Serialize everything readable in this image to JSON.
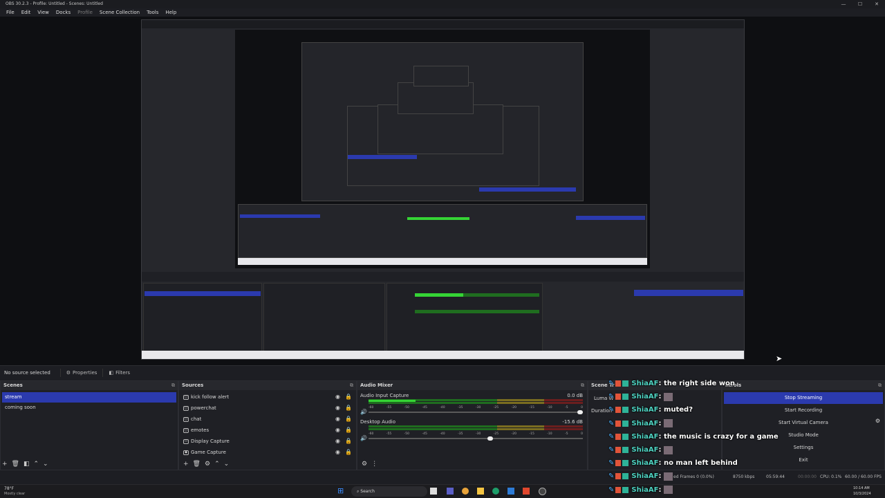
{
  "window": {
    "title": "OBS 30.2.3 - Profile: Untitled - Scenes: Untitled",
    "controls": [
      "—",
      "☐",
      "✕"
    ]
  },
  "menu": [
    "File",
    "Edit",
    "View",
    "Docks",
    "Profile",
    "Scene Collection",
    "Tools",
    "Help"
  ],
  "source_bar": {
    "label": "No source selected",
    "properties": "Properties",
    "filters": "Filters"
  },
  "scenes": {
    "title": "Scenes",
    "items": [
      "stream",
      "coming soon"
    ],
    "selected": "stream"
  },
  "sources": {
    "title": "Sources",
    "items": [
      {
        "name": "kick follow alert",
        "icon": "globe-icon"
      },
      {
        "name": "powerchat",
        "icon": "globe-icon"
      },
      {
        "name": "chat",
        "icon": "globe-icon"
      },
      {
        "name": "emotes",
        "icon": "globe-icon"
      },
      {
        "name": "Display Capture",
        "icon": "monitor-icon"
      },
      {
        "name": "Game Capture",
        "icon": "gamepad-icon"
      }
    ]
  },
  "audio_mixer": {
    "title": "Audio Mixer",
    "channels": [
      {
        "name": "Audio Input Capture",
        "db": "0.0 dB",
        "level": 0.22,
        "volume": 1.0
      },
      {
        "name": "Desktop Audio",
        "db": "-15.6 dB",
        "level": 0.0,
        "volume": 0.58
      }
    ],
    "ticks": [
      "-60",
      "-55",
      "-50",
      "-45",
      "-40",
      "-35",
      "-30",
      "-25",
      "-20",
      "-15",
      "-10",
      "-5",
      "0"
    ]
  },
  "transitions": {
    "title": "Scene Tr",
    "transition": "Luma W",
    "duration_label": "Duration"
  },
  "controls": {
    "title": "ntrols",
    "buttons": [
      "Stop Streaming",
      "Start Recording",
      "Start Virtual Camera",
      "Studio Mode",
      "Settings",
      "Exit"
    ],
    "active": "Stop Streaming"
  },
  "status": {
    "frames": "ed Frames 0 (0.0%)",
    "kbps": "8750 kbps",
    "stream_time": "05:59:44",
    "rec_time": "00:00:00",
    "cpu": "CPU: 0.1%",
    "fps": "60.00 / 60.00 FPS"
  },
  "taskbar": {
    "weather_temp": "78°F",
    "weather_desc": "Mostly clear",
    "search": "Search",
    "time": "10:14 AM",
    "date": "10/3/2024"
  },
  "chat": {
    "user": "ShiaAF",
    "messages": [
      {
        "text": ": the right side won",
        "img": false
      },
      {
        "text": ": ",
        "img": true
      },
      {
        "text": ": muted?",
        "img": false
      },
      {
        "text": ": ",
        "img": true
      },
      {
        "text": ": the music is crazy for a game",
        "img": false
      },
      {
        "text": ": ",
        "img": true
      },
      {
        "text": ": no man left behind",
        "img": false
      },
      {
        "text": ": ",
        "img": true
      },
      {
        "text": ": ",
        "img": true
      }
    ]
  },
  "colors": {
    "accent": "#2b3aae",
    "meter_green": "#35d435",
    "chat_user": "#4ed3c2"
  }
}
